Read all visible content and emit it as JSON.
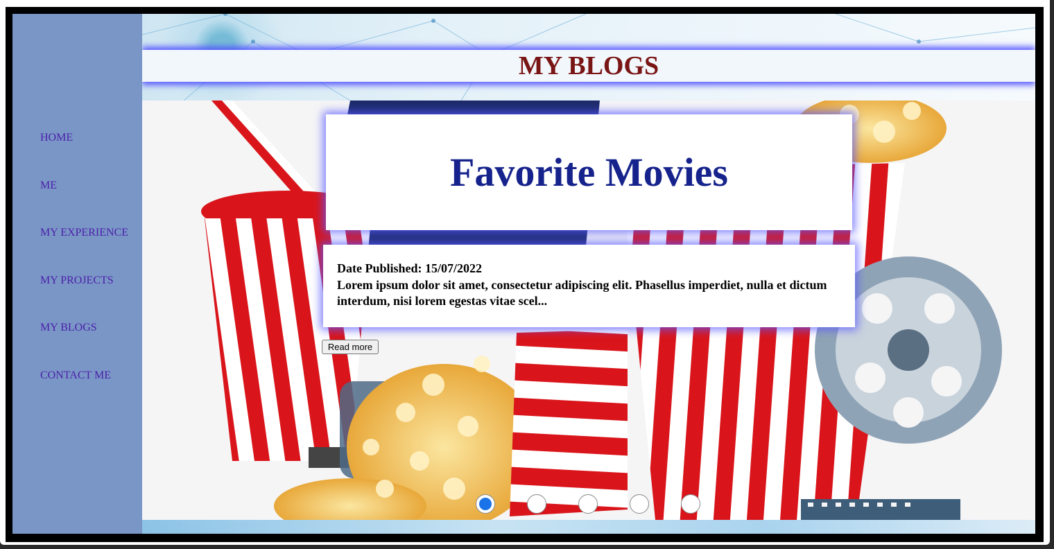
{
  "header": {
    "title": "MY BLOGS"
  },
  "sidebar": {
    "items": [
      {
        "label": "HOME"
      },
      {
        "label": "ME"
      },
      {
        "label": "MY EXPERIENCE"
      },
      {
        "label": "MY PROJECTS"
      },
      {
        "label": "MY BLOGS"
      },
      {
        "label": "CONTACT ME"
      }
    ]
  },
  "post": {
    "title": "Favorite Movies",
    "date": "Date Published: 15/07/2022",
    "excerpt": "Lorem ipsum dolor sit amet, consectetur adipiscing elit. Phasellus imperdiet, nulla et dictum interdum, nisi lorem egestas vitae scel...",
    "read_more_label": "Read more"
  },
  "slider": {
    "count": 5,
    "active_index": 0,
    "active_color": "#1a73e8"
  },
  "colors": {
    "title": "#7a1515",
    "sidebar_bg": "#7a96c7",
    "nav_link": "#4a1fa8",
    "card_title": "#16238c",
    "glow": "#5a5aff"
  },
  "hero_image": {
    "icon": "popcorn-movie-illustration"
  }
}
